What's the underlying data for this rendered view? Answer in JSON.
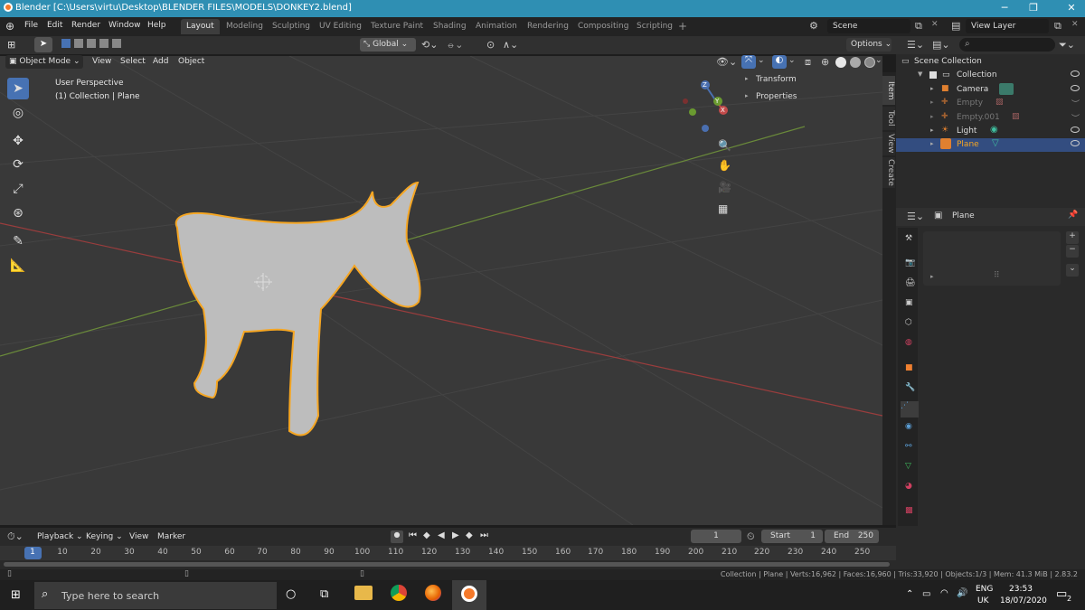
{
  "title": "Blender [C:\\Users\\virtu\\Desktop\\BLENDER FILES\\MODELS\\DONKEY2.blend]",
  "menu": [
    "File",
    "Edit",
    "Render",
    "Window",
    "Help"
  ],
  "workspaces": [
    "Layout",
    "Modeling",
    "Sculpting",
    "UV Editing",
    "Texture Paint",
    "Shading",
    "Animation",
    "Rendering",
    "Compositing",
    "Scripting"
  ],
  "scene": "Scene",
  "view_layer": "View Layer",
  "header": {
    "transform": "Global",
    "options": "Options",
    "mode": "Object Mode",
    "menus": [
      "View",
      "Select",
      "Add",
      "Object"
    ]
  },
  "viewport": {
    "perspective": "User Perspective",
    "collection_info": "(1) Collection | Plane",
    "transform": "Transform",
    "properties": "Properties",
    "tabs": [
      "Item",
      "Tool",
      "View",
      "Create"
    ],
    "gizmo": {
      "x": "X",
      "y": "Y",
      "z": "Z"
    }
  },
  "outliner": {
    "root": "Scene Collection",
    "collection": "Collection",
    "items": [
      "Camera",
      "Empty",
      "Empty.001",
      "Light",
      "Plane"
    ],
    "selected": "Plane"
  },
  "properties": {
    "object_name": "Plane"
  },
  "timeline": {
    "menus": [
      "Playback",
      "Keying",
      "View",
      "Marker"
    ],
    "current_frame": "1",
    "start_label": "Start",
    "start": "1",
    "end_label": "End",
    "end": "250",
    "ticks": [
      "1",
      "10",
      "20",
      "30",
      "40",
      "50",
      "60",
      "70",
      "80",
      "90",
      "100",
      "110",
      "120",
      "130",
      "140",
      "150",
      "160",
      "170",
      "180",
      "190",
      "200",
      "210",
      "220",
      "230",
      "240",
      "250"
    ]
  },
  "status": "Collection | Plane | Verts:16,962 | Faces:16,960 | Tris:33,920 | Objects:1/3 | Mem: 41.3 MiB | 2.83.2",
  "taskbar": {
    "search_placeholder": "Type here to search",
    "lang1": "ENG",
    "lang2": "UK",
    "time": "23:53",
    "date": "18/07/2020",
    "notif": "2"
  },
  "colors": {
    "accent": "#4772b3",
    "selection": "#f5a623",
    "title": "#2f8fb3"
  }
}
